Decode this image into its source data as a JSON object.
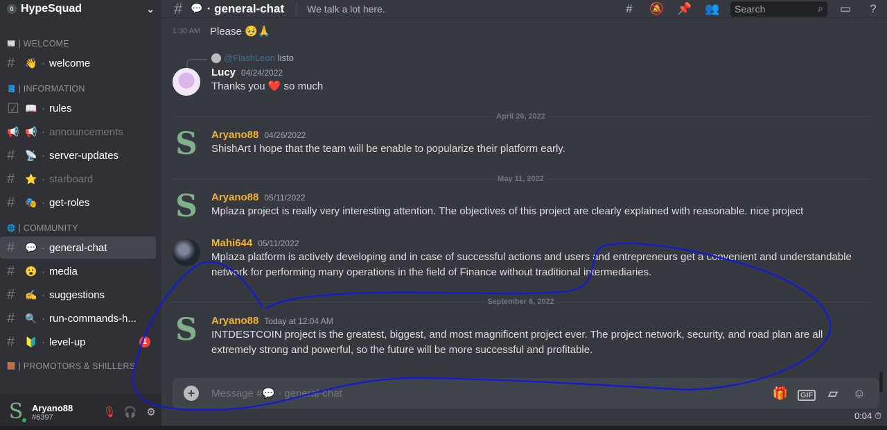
{
  "server": {
    "badge": "0",
    "name": "HypeSquad"
  },
  "sidebar": {
    "categories": [
      {
        "label": "| WELCOME",
        "icon": "📰"
      },
      {
        "label": "| INFORMATION",
        "icon": "📘"
      },
      {
        "label": "| COMMUNITY",
        "icon": "🌐"
      },
      {
        "label": "| PROMOTORS & SHILLERS",
        "icon": "🟫"
      }
    ],
    "channels": [
      {
        "icon": "#",
        "emoji": "👋",
        "name": "welcome"
      },
      {
        "icon": "☑",
        "emoji": "📖",
        "name": "rules"
      },
      {
        "icon": "📢",
        "emoji": "📢",
        "name": "announcements"
      },
      {
        "icon": "#",
        "emoji": "📡",
        "name": "server-updates"
      },
      {
        "icon": "#",
        "emoji": "⭐",
        "name": "starboard"
      },
      {
        "icon": "#",
        "emoji": "🎭",
        "name": "get-roles"
      },
      {
        "icon": "#",
        "emoji": "💬",
        "name": "general-chat"
      },
      {
        "icon": "#",
        "emoji": "😮",
        "name": "media"
      },
      {
        "icon": "#",
        "emoji": "✍",
        "name": "suggestions"
      },
      {
        "icon": "#",
        "emoji": "🔍",
        "name": "run-commands-h..."
      },
      {
        "icon": "#",
        "emoji": "🔰",
        "name": "level-up",
        "unread": "1"
      }
    ]
  },
  "user": {
    "name": "Aryano88",
    "tag": "#6397"
  },
  "topbar": {
    "hash": "#",
    "emoji": "💬",
    "channel": "· general-chat",
    "topic": "We talk a lot here.",
    "search_placeholder": "Search"
  },
  "messages": {
    "compact": {
      "time": "1:30 AM",
      "text": "Please 🥺🙏"
    },
    "reply": {
      "mention": "@FlashLeon",
      "text": "listo"
    },
    "lucy": {
      "author": "Lucy",
      "ts": "04/24/2022",
      "text": "Thanks you ❤️ so much"
    },
    "divider1": "April 26, 2022",
    "m1": {
      "author": "Aryano88",
      "ts": "04/26/2022",
      "text": "ShishArt I hope that the team will be enable to popularize their platform early."
    },
    "divider2": "May 11, 2022",
    "m2": {
      "author": "Aryano88",
      "ts": "05/11/2022",
      "text": "Mplaza project is really very interesting attention. The objectives of this project are clearly explained with reasonable. nice project"
    },
    "m3": {
      "author": "Mahi644",
      "ts": "05/11/2022",
      "text": "Mplaza platform is actively developing and in case of successful actions and users and entrepreneurs get a convenient and understandable network for performing many operations in the field of Finance without traditional intermediaries."
    },
    "divider3": "September 6, 2022",
    "m4": {
      "author": "Aryano88",
      "ts": "Today at 12:04 AM",
      "text": "INTDESTCOIN project is the greatest, biggest, and most magnificent project ever. The project network, security, and road plan are all extremely strong and powerful, so the future will be more successful and profitable."
    }
  },
  "composer": {
    "placeholder": "Message #💬 · general-chat",
    "gif": "GIF"
  },
  "timer": "0:04 ⏱",
  "colors": {
    "author_gold": "#f0b232",
    "sidebar": "#2f3136",
    "chat": "#36393f",
    "annotation": "#1418d8"
  }
}
